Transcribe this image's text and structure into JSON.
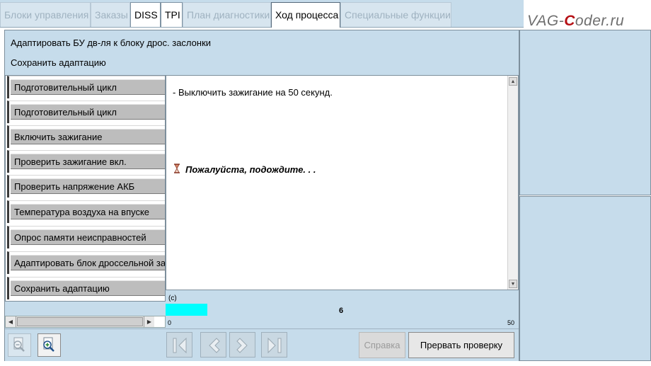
{
  "tabs": [
    {
      "label": "Блоки управления",
      "state": "disabled"
    },
    {
      "label": "Заказы",
      "state": "disabled"
    },
    {
      "label": "DISS",
      "state": "enabled"
    },
    {
      "label": "TPI",
      "state": "enabled"
    },
    {
      "label": "План диагностики",
      "state": "disabled"
    },
    {
      "label": "Ход процесса",
      "state": "active"
    },
    {
      "label": "Специальные функции",
      "state": "disabled"
    }
  ],
  "logo": {
    "prefix": "VAG-",
    "accent": "C",
    "suffix": "oder.ru"
  },
  "header": {
    "title": "Адаптировать БУ дв-ля к блоку дрос. заслонки",
    "subtitle": "Сохранить адаптацию"
  },
  "steps": [
    {
      "label": "Подготовительный цикл"
    },
    {
      "label": "Подготовительный цикл"
    },
    {
      "label": "Включить зажигание"
    },
    {
      "label": "Проверить зажигание вкл."
    },
    {
      "label": "Проверить напряжение АКБ"
    },
    {
      "label": "Температура воздуха на впуске"
    },
    {
      "label": "Опрос памяти неисправностей"
    },
    {
      "label": "Адаптировать блок дроссельной заслонки"
    },
    {
      "label": "Сохранить адаптацию"
    }
  ],
  "message": {
    "line": "- Выключить зажигание на 50 секунд.",
    "wait": "Пожалуйста, подождите. . ."
  },
  "progress": {
    "label": "(c)",
    "value": 6,
    "value_text": "6",
    "min": 0,
    "min_text": "0",
    "max": 50,
    "max_text": "50"
  },
  "buttons": {
    "help": "Справка",
    "abort": "Прервать проверку"
  },
  "icons": {
    "zoom_out": "zoom-out-icon",
    "zoom_in": "zoom-in-icon",
    "first": "skip-first-icon",
    "prev": "chevron-left-icon",
    "next": "chevron-right-icon",
    "last": "skip-last-icon",
    "wait": "hourglass-icon"
  },
  "colors": {
    "panel": "#c6dceb",
    "progress_fill": "#00ffff",
    "logo_accent": "#b50f14"
  }
}
